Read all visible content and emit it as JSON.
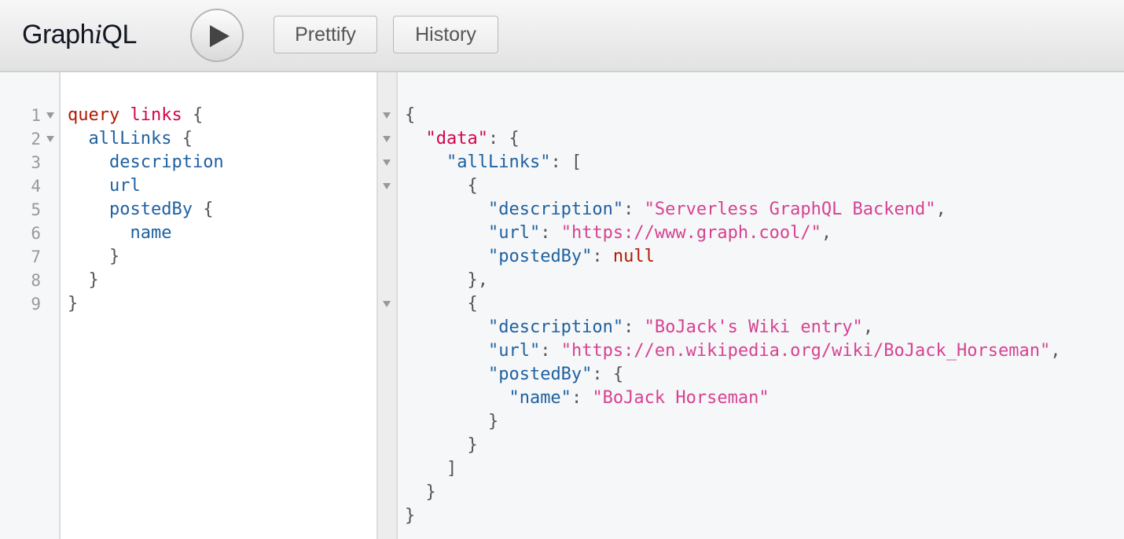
{
  "app": {
    "title_prefix": "Graph",
    "title_italic": "i",
    "title_suffix": "QL"
  },
  "toolbar": {
    "run_icon": "play-icon",
    "prettify_label": "Prettify",
    "history_label": "History"
  },
  "query_editor": {
    "line_numbers": [
      "1",
      "2",
      "3",
      "4",
      "5",
      "6",
      "7",
      "8",
      "9"
    ],
    "folds": [
      1,
      2
    ],
    "lines": [
      [
        {
          "t": "kw",
          "v": "query"
        },
        {
          "t": "punc",
          "v": " "
        },
        {
          "t": "def",
          "v": "links"
        },
        {
          "t": "punc",
          "v": " {"
        }
      ],
      [
        {
          "t": "punc",
          "v": "  "
        },
        {
          "t": "prop",
          "v": "allLinks"
        },
        {
          "t": "punc",
          "v": " {"
        }
      ],
      [
        {
          "t": "punc",
          "v": "    "
        },
        {
          "t": "prop",
          "v": "description"
        }
      ],
      [
        {
          "t": "punc",
          "v": "    "
        },
        {
          "t": "prop",
          "v": "url"
        }
      ],
      [
        {
          "t": "punc",
          "v": "    "
        },
        {
          "t": "prop",
          "v": "postedBy"
        },
        {
          "t": "punc",
          "v": " {"
        }
      ],
      [
        {
          "t": "punc",
          "v": "      "
        },
        {
          "t": "prop",
          "v": "name"
        }
      ],
      [
        {
          "t": "punc",
          "v": "    }"
        }
      ],
      [
        {
          "t": "punc",
          "v": "  }"
        }
      ],
      [
        {
          "t": "punc",
          "v": "}"
        }
      ]
    ]
  },
  "result_viewer": {
    "folds": [
      1,
      2,
      3,
      4,
      9
    ],
    "lines": [
      [
        {
          "t": "brace",
          "v": "{"
        }
      ],
      [
        {
          "t": "brace",
          "v": "  "
        },
        {
          "t": "def",
          "v": "\"data\""
        },
        {
          "t": "brace",
          "v": ": {"
        }
      ],
      [
        {
          "t": "brace",
          "v": "    "
        },
        {
          "t": "attr",
          "v": "\"allLinks\""
        },
        {
          "t": "brace",
          "v": ": ["
        }
      ],
      [
        {
          "t": "brace",
          "v": "      {"
        }
      ],
      [
        {
          "t": "brace",
          "v": "        "
        },
        {
          "t": "attr",
          "v": "\"description\""
        },
        {
          "t": "brace",
          "v": ": "
        },
        {
          "t": "str",
          "v": "\"Serverless GraphQL Backend\""
        },
        {
          "t": "brace",
          "v": ","
        }
      ],
      [
        {
          "t": "brace",
          "v": "        "
        },
        {
          "t": "attr",
          "v": "\"url\""
        },
        {
          "t": "brace",
          "v": ": "
        },
        {
          "t": "str",
          "v": "\"https://www.graph.cool/\""
        },
        {
          "t": "brace",
          "v": ","
        }
      ],
      [
        {
          "t": "brace",
          "v": "        "
        },
        {
          "t": "attr",
          "v": "\"postedBy\""
        },
        {
          "t": "brace",
          "v": ": "
        },
        {
          "t": "nul",
          "v": "null"
        }
      ],
      [
        {
          "t": "brace",
          "v": "      },"
        }
      ],
      [
        {
          "t": "brace",
          "v": "      {"
        }
      ],
      [
        {
          "t": "brace",
          "v": "        "
        },
        {
          "t": "attr",
          "v": "\"description\""
        },
        {
          "t": "brace",
          "v": ": "
        },
        {
          "t": "str",
          "v": "\"BoJack's Wiki entry\""
        },
        {
          "t": "brace",
          "v": ","
        }
      ],
      [
        {
          "t": "brace",
          "v": "        "
        },
        {
          "t": "attr",
          "v": "\"url\""
        },
        {
          "t": "brace",
          "v": ": "
        },
        {
          "t": "str",
          "v": "\"https://en.wikipedia.org/wiki/BoJack_Horseman\""
        },
        {
          "t": "brace",
          "v": ","
        }
      ],
      [
        {
          "t": "brace",
          "v": "        "
        },
        {
          "t": "attr",
          "v": "\"postedBy\""
        },
        {
          "t": "brace",
          "v": ": {"
        }
      ],
      [
        {
          "t": "brace",
          "v": "          "
        },
        {
          "t": "attr",
          "v": "\"name\""
        },
        {
          "t": "brace",
          "v": ": "
        },
        {
          "t": "str",
          "v": "\"BoJack Horseman\""
        }
      ],
      [
        {
          "t": "brace",
          "v": "        }"
        }
      ],
      [
        {
          "t": "brace",
          "v": "      }"
        }
      ],
      [
        {
          "t": "brace",
          "v": "    ]"
        }
      ],
      [
        {
          "t": "brace",
          "v": "  }"
        }
      ],
      [
        {
          "t": "brace",
          "v": "}"
        }
      ]
    ]
  },
  "colors": {
    "keyword": "#b11a04",
    "definition": "#d2054e",
    "property": "#1f61a0",
    "string": "#d64292",
    "punctuation": "#555555",
    "gutter_text": "#999999"
  }
}
